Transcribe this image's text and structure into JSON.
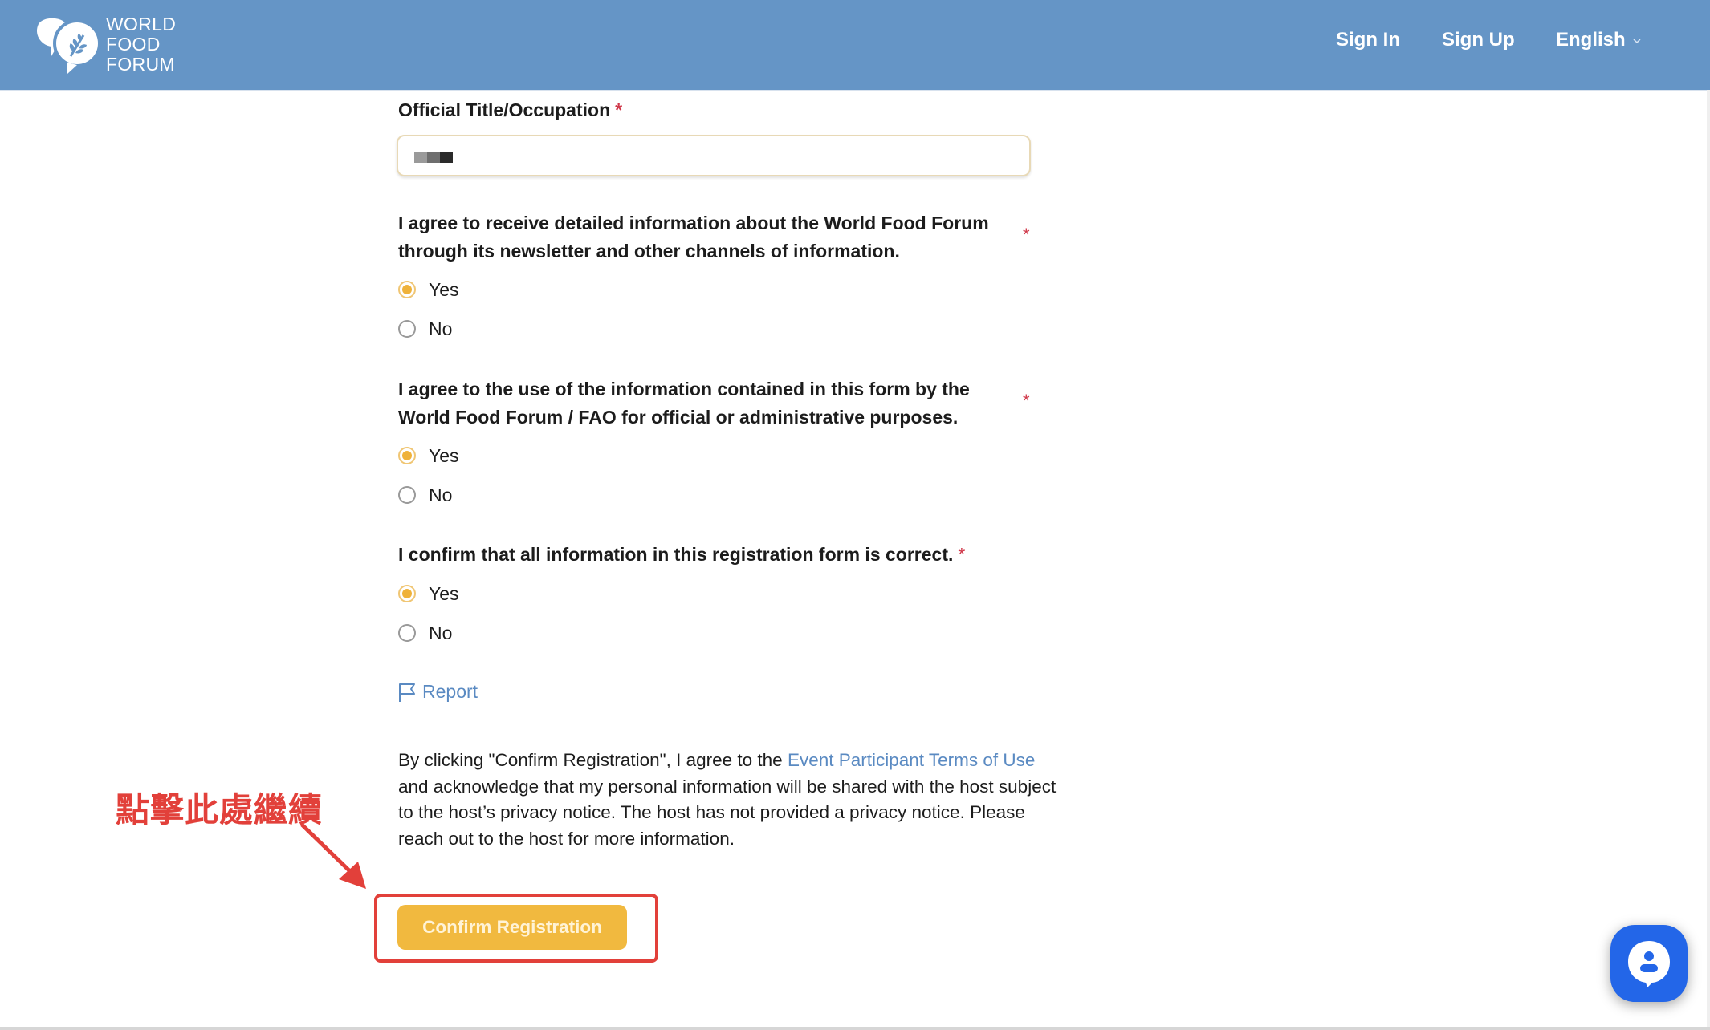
{
  "header": {
    "logo": {
      "line1": "WORLD",
      "line2": "FOOD",
      "line3": "FORUM",
      "icon": "speech-bubbles-wheat-icon"
    },
    "nav": {
      "sign_in": "Sign In",
      "sign_up": "Sign Up",
      "language": "English"
    },
    "color": "#6595c6"
  },
  "form": {
    "title_field": {
      "label": "Official Title/Occupation",
      "required_mark": "*",
      "value_redacted": true
    },
    "questions": [
      {
        "text": "I agree to receive detailed information about the World Food Forum through its newsletter and other channels of information.",
        "required_mark": "*",
        "options": [
          {
            "label": "Yes",
            "checked": true
          },
          {
            "label": "No",
            "checked": false
          }
        ]
      },
      {
        "text": "I agree to the use of the information contained in this form by the World Food Forum / FAO for official or administrative purposes.",
        "required_mark": "*",
        "options": [
          {
            "label": "Yes",
            "checked": true
          },
          {
            "label": "No",
            "checked": false
          }
        ]
      },
      {
        "text": "I confirm that all information in this registration form is correct.",
        "required_mark": "*",
        "options": [
          {
            "label": "Yes",
            "checked": true
          },
          {
            "label": "No",
            "checked": false
          }
        ]
      }
    ],
    "report_label": "Report",
    "disclaimer": {
      "before_link": "By clicking \"Confirm Registration\", I agree to the ",
      "link_text": "Event Participant Terms of Use",
      "after_link": " and acknowledge that my personal information will be shared with the host subject to the host’s privacy notice. The host has not provided a privacy notice. Please reach out to the host for more information."
    },
    "confirm_button": "Confirm Registration"
  },
  "annotation": {
    "text": "點擊此處繼續",
    "color": "#e2403a"
  },
  "chat_widget": {
    "icon": "chat-support-icon",
    "color": "#2366e8"
  },
  "colors": {
    "accent": "#f1b93f",
    "link": "#5a8ac2",
    "required": "#d0384a"
  }
}
